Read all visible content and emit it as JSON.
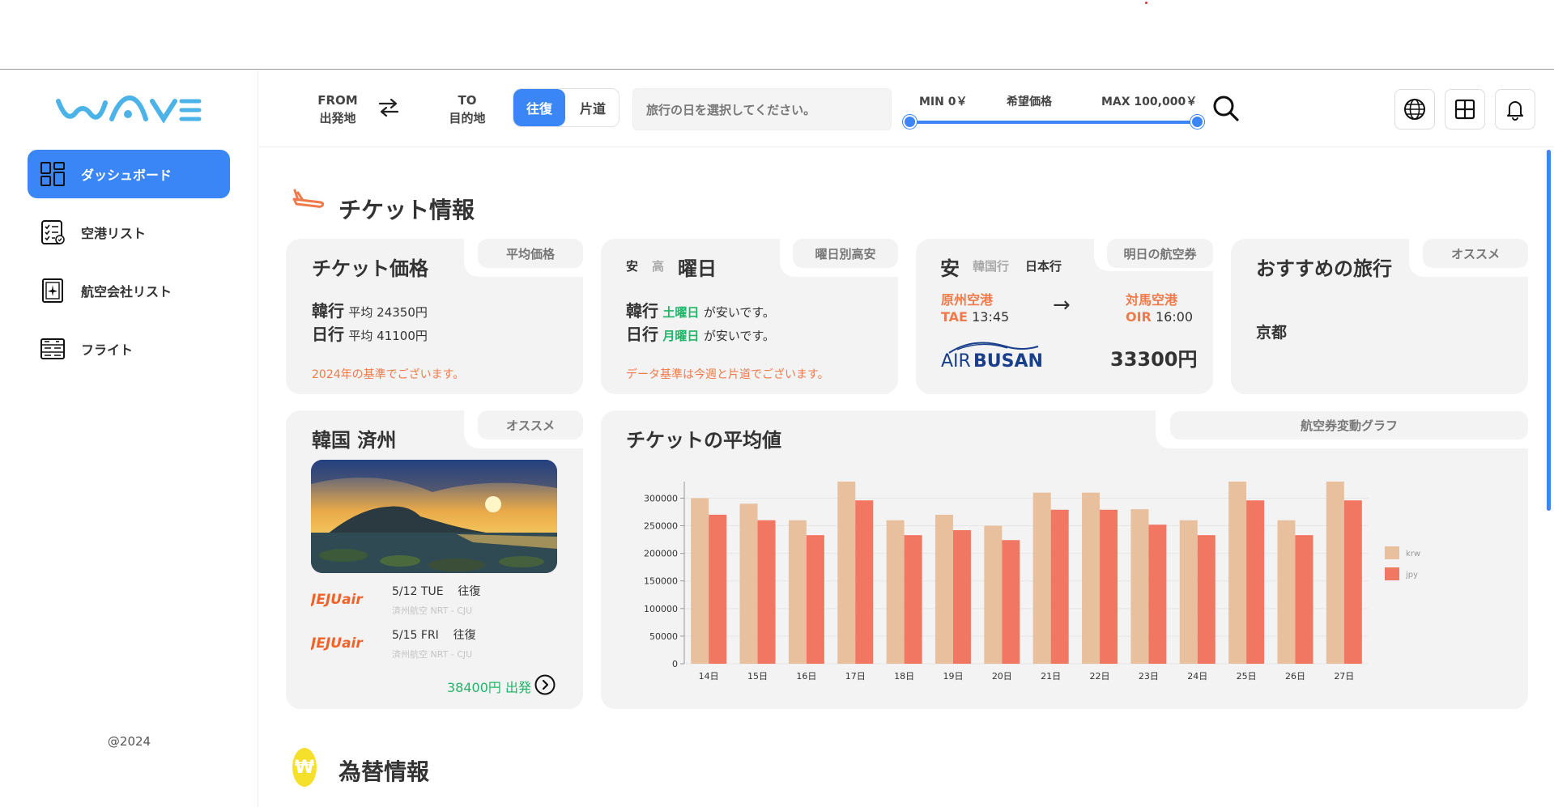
{
  "header": {
    "from_en": "FROM",
    "from_jp": "出発地",
    "to_en": "TO",
    "to_jp": "目的地",
    "round_trip": "往復",
    "one_way": "片道",
    "date_placeholder": "旅行の日を選択してください。",
    "min_price": "MIN 0￥",
    "price_label": "希望価格",
    "max_price": "MAX 100,000￥",
    "price_range_fraction": [
      0.0,
      1.0
    ]
  },
  "sidebar": {
    "items": [
      {
        "label": "ダッシュボード",
        "icon": "dashboard-icon",
        "active": true
      },
      {
        "label": "空港リスト",
        "icon": "checklist-icon",
        "active": false
      },
      {
        "label": "航空会社リスト",
        "icon": "airline-icon",
        "active": false
      },
      {
        "label": "フライト",
        "icon": "flight-board-icon",
        "active": false
      }
    ],
    "copyright": "@2024"
  },
  "ticket_section": {
    "title": "チケット情報",
    "price_card": {
      "title": "チケット価格",
      "tag": "平均価格",
      "row1_dest": "韓行",
      "row1_text": "平均 24350円",
      "row2_dest": "日行",
      "row2_text": "平均 41100円",
      "note": "2024年の基準でございます。"
    },
    "weekday_card": {
      "cheap": "安",
      "high": "高",
      "title": "曜日",
      "tag": "曜日別高安",
      "row1_dest": "韓行",
      "row1_day": "土曜日",
      "row1_suffix": "が安いです。",
      "row2_dest": "日行",
      "row2_day": "月曜日",
      "row2_suffix": "が安いです。",
      "note": "データ基準は今週と片道でございます。"
    },
    "tomorrow_card": {
      "cheap": "安",
      "korea": "韓国行",
      "japan": "日本行",
      "tag": "明日の航空券",
      "from_airport": "原州空港",
      "from_code": "TAE",
      "from_time": "13:45",
      "to_airport": "対馬空港",
      "to_code": "OIR",
      "to_time": "16:00",
      "arrow": "→",
      "airline_air": "AIR",
      "airline_busan": "BUSAN",
      "price": "33300円"
    },
    "recommend_card": {
      "title": "おすすめの旅行",
      "tag": "オススメ",
      "destination": "京都"
    },
    "jeju_card": {
      "title": "韓国 済州",
      "tag": "オススメ",
      "flights": [
        {
          "airline": "JEJUair",
          "date": "5/12 TUE",
          "type": "往復",
          "route": "済州航空 NRT - CJU"
        },
        {
          "airline": "JEJUair",
          "date": "5/15 FRI",
          "type": "往復",
          "route": "済州航空 NRT - CJU"
        }
      ],
      "price": "38400円 出発"
    },
    "chart_card": {
      "title": "チケットの平均値",
      "tag": "航空券変動グラフ"
    }
  },
  "exchange_section": {
    "title": "為替情報",
    "icon_symbol": "₩"
  },
  "chart_data": {
    "type": "bar",
    "categories": [
      "14日",
      "15日",
      "16日",
      "17日",
      "18日",
      "19日",
      "20日",
      "21日",
      "22日",
      "23日",
      "24日",
      "25日",
      "26日",
      "27日"
    ],
    "series": [
      {
        "name": "krw",
        "color": "#e8c09e",
        "values": [
          300000,
          290000,
          260000,
          330000,
          260000,
          270000,
          250000,
          310000,
          310000,
          280000,
          260000,
          330000,
          260000,
          330000
        ]
      },
      {
        "name": "jpy",
        "color": "#f27762",
        "values": [
          270000,
          260000,
          233000,
          296000,
          233000,
          242000,
          224000,
          279000,
          279000,
          252000,
          233000,
          296000,
          233000,
          296000
        ]
      }
    ],
    "yticks": [
      0,
      50000,
      100000,
      150000,
      200000,
      250000,
      300000
    ],
    "ylim": [
      0,
      330000
    ],
    "legend": "right",
    "grid": true
  }
}
